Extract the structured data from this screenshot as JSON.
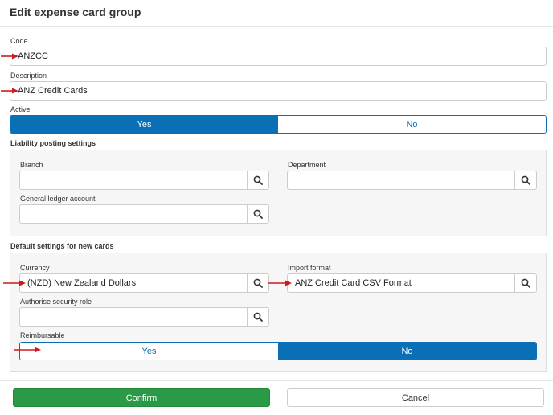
{
  "dialog": {
    "title": "Edit expense card group"
  },
  "code": {
    "label": "Code",
    "value": "ANZCC"
  },
  "description": {
    "label": "Description",
    "value": "ANZ Credit Cards"
  },
  "active": {
    "label": "Active",
    "yes": "Yes",
    "no": "No",
    "selected": "Yes"
  },
  "liability": {
    "heading": "Liability posting settings",
    "branch_label": "Branch",
    "branch_value": "",
    "department_label": "Department",
    "department_value": "",
    "gl_label": "General ledger account",
    "gl_value": ""
  },
  "defaults": {
    "heading": "Default settings for new cards",
    "currency_label": "Currency",
    "currency_value": "(NZD) New Zealand Dollars",
    "import_label": "Import format",
    "import_value": "ANZ Credit Card CSV Format",
    "role_label": "Authorise security role",
    "role_value": "",
    "reimb_label": "Reimbursable",
    "reimb_yes": "Yes",
    "reimb_no": "No",
    "reimb_selected": "No"
  },
  "buttons": {
    "confirm": "Confirm",
    "cancel": "Cancel"
  },
  "colors": {
    "primary": "#0b6fb6",
    "confirm": "#2a9a47",
    "annotation": "#d0191c"
  },
  "icons": {
    "lookup": "search-icon",
    "annotation": "red-arrow-annotation"
  }
}
